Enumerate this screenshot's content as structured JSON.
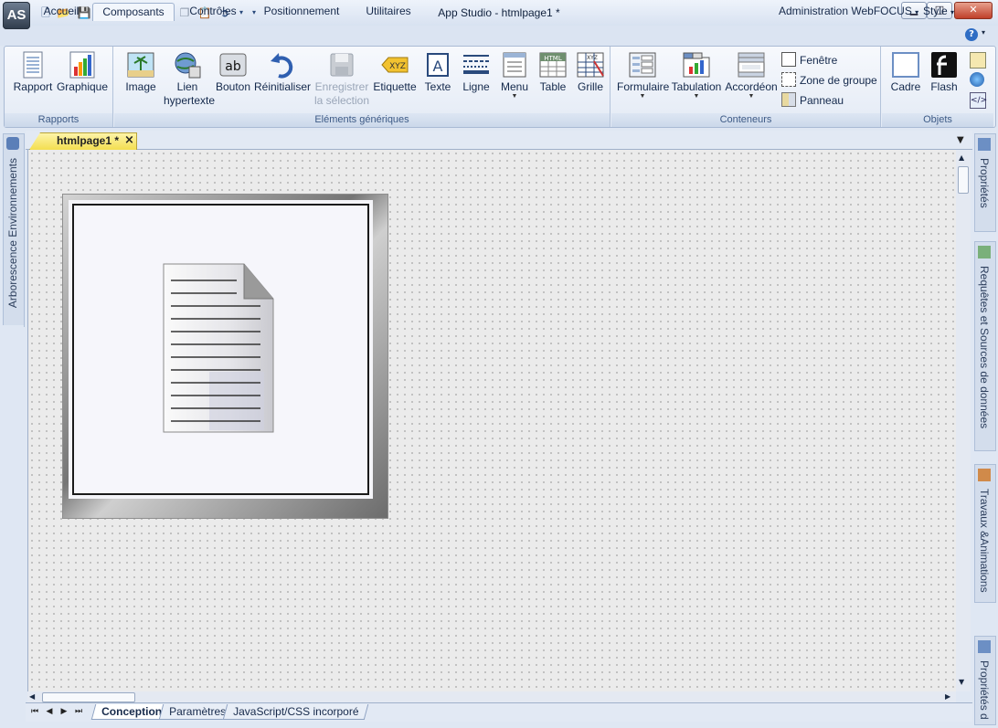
{
  "window": {
    "title": "App Studio - htmlpage1 *",
    "logo_text": "AS",
    "controls": {
      "minimize": "▁",
      "maximize": "□",
      "close": "✕"
    }
  },
  "quick_access_icons": [
    "new-file-icon",
    "open-folder-icon",
    "save-icon",
    "print-icon",
    "undo-icon",
    "redo-icon",
    "cut-icon",
    "copy-icon",
    "paste-icon",
    "run-icon",
    "dropdown-icon",
    "customize-icon"
  ],
  "ribbon_tabs": [
    "Accueil",
    "Composants",
    "Contrôles",
    "Positionnement",
    "Utilitaires"
  ],
  "active_tab": "Composants",
  "ribbon_right": {
    "admin": "Administration WebFOCUS",
    "style": "Style",
    "help": "?"
  },
  "groups": {
    "rapports": {
      "label": "Rapports",
      "buttons": [
        {
          "label": "Rapport",
          "icon": "report-icon"
        },
        {
          "label": "Graphique",
          "icon": "chart-icon"
        }
      ]
    },
    "generiques": {
      "label": "Eléments génériques",
      "buttons": [
        {
          "label": "Image",
          "icon": "image-icon"
        },
        {
          "label": "Lien",
          "label2": "hypertexte",
          "icon": "hyperlink-icon"
        },
        {
          "label": "Bouton",
          "icon": "button-icon",
          "badge": "ab"
        },
        {
          "label": "Réinitialiser",
          "icon": "reset-icon"
        },
        {
          "label": "Enregistrer",
          "label2": "la sélection",
          "icon": "save-selection-icon",
          "disabled": true
        },
        {
          "label": "Etiquette",
          "icon": "label-icon",
          "badge": "XYZ"
        },
        {
          "label": "Texte",
          "icon": "text-icon",
          "badge": "A"
        },
        {
          "label": "Ligne",
          "icon": "line-icon"
        },
        {
          "label": "Menu",
          "icon": "menu-icon",
          "dropdown": true
        },
        {
          "label": "Table",
          "icon": "table-icon",
          "badge": "HTML"
        },
        {
          "label": "Grille",
          "icon": "grid-icon",
          "badge": "XYZ"
        }
      ]
    },
    "conteneurs": {
      "label": "Conteneurs",
      "buttons": [
        {
          "label": "Formulaire",
          "icon": "form-icon",
          "dropdown": true
        },
        {
          "label": "Tabulation",
          "icon": "tab-icon",
          "dropdown": true
        },
        {
          "label": "Accordéon",
          "icon": "accordion-icon",
          "dropdown": true
        }
      ],
      "small": [
        {
          "label": "Fenêtre",
          "icon": "window-icon"
        },
        {
          "label": "Zone de groupe",
          "icon": "group-box-icon"
        },
        {
          "label": "Panneau",
          "icon": "panel-icon"
        }
      ]
    },
    "objets": {
      "label": "Objets",
      "buttons": [
        {
          "label": "Cadre",
          "icon": "frame-icon"
        },
        {
          "label": "Flash",
          "icon": "flash-icon"
        }
      ]
    }
  },
  "left_panel": {
    "label": "Arborescence Environnements"
  },
  "right_panels": [
    "Propriétés",
    "Requêtes et Sources de données",
    "Travaux &Animations",
    "Propriétés d"
  ],
  "document_tab": {
    "label": "htmlpage1 *",
    "close": "×"
  },
  "bottom_tabs": [
    "Conception",
    "Paramètres",
    "JavaScript/CSS incorporé"
  ],
  "active_bottom_tab": "Conception",
  "colors": {
    "accent": "#2a4a7c",
    "doc_tab": "#f3de50",
    "canvas": "#ebebeb"
  }
}
